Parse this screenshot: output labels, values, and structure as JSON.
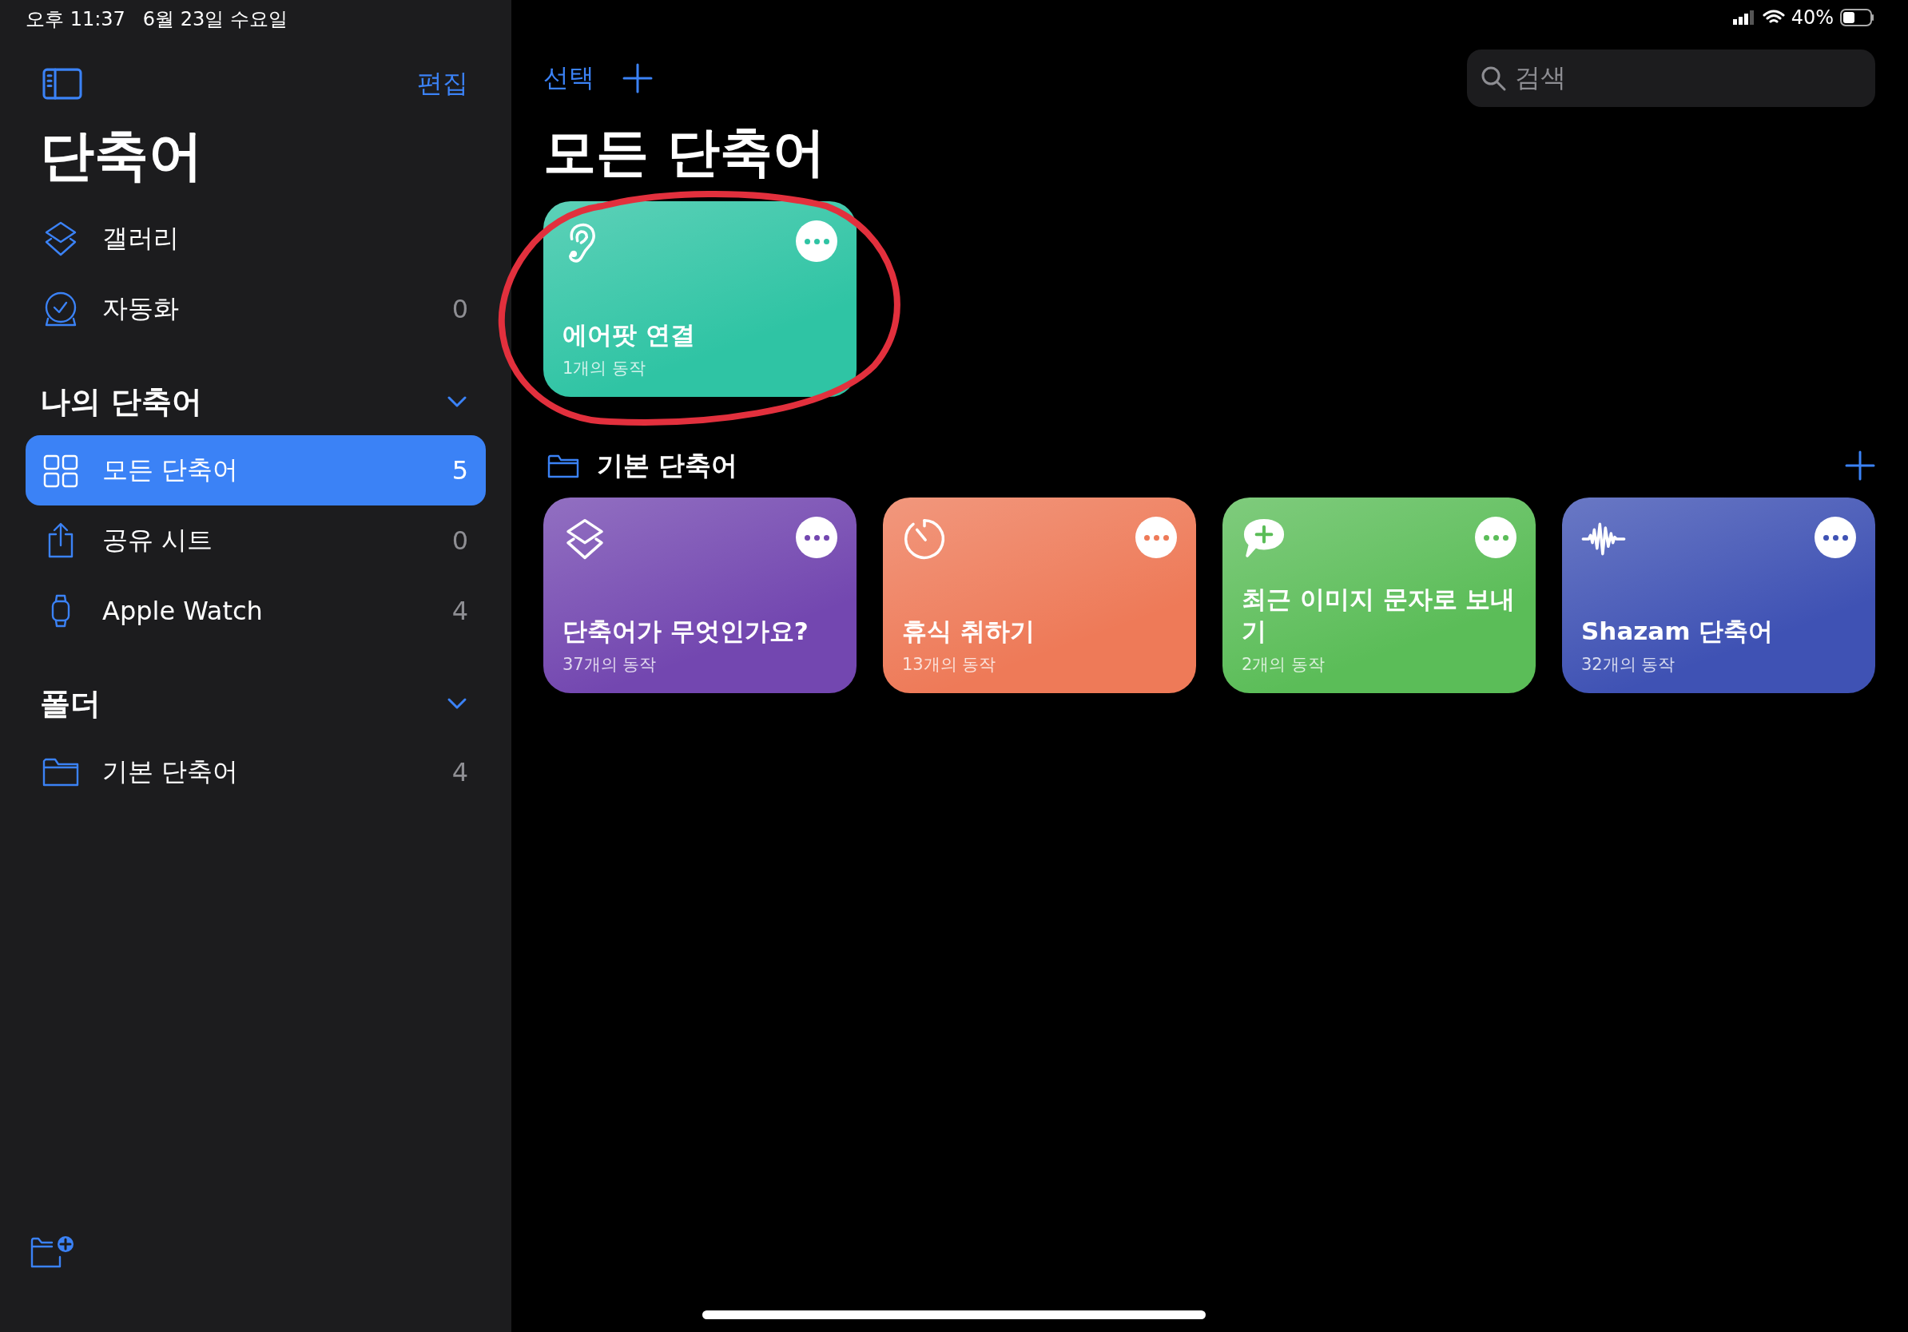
{
  "status_bar": {
    "time": "오후 11:37",
    "date": "6월 23일 수요일",
    "battery": "40%"
  },
  "sidebar": {
    "edit_button": "편집",
    "title": "단축어",
    "items": [
      {
        "label": "갤러리"
      },
      {
        "label": "자동화",
        "count": "0"
      }
    ],
    "sections": [
      {
        "title": "나의 단축어",
        "expanded": true,
        "items": [
          {
            "label": "모든 단축어",
            "count": "5",
            "selected": true
          },
          {
            "label": "공유 시트",
            "count": "0",
            "selected": false
          },
          {
            "label": "Apple Watch",
            "count": "4",
            "selected": false
          }
        ]
      },
      {
        "title": "폴더",
        "expanded": true,
        "items": [
          {
            "label": "기본 단축어",
            "count": "4",
            "selected": false
          }
        ]
      }
    ]
  },
  "main": {
    "select_button": "선택",
    "search": {
      "placeholder": "검색"
    },
    "title": "모든 단축어",
    "shortcuts": [
      {
        "title": "에어팟 연결",
        "subtitle": "1개의 동작",
        "color": "#2fc4a4",
        "highlighted": true
      }
    ],
    "folder": {
      "title": "기본 단축어",
      "shortcuts": [
        {
          "title": "단축어가 무엇인가요?",
          "subtitle": "37개의 동작",
          "color": "#7347b0",
          "highlighted": false
        },
        {
          "title": "휴식 취하기",
          "subtitle": "13개의 동작",
          "color": "#ee7a58",
          "highlighted": false
        },
        {
          "title": "최근 이미지 문자로 보내기",
          "subtitle": "2개의 동작",
          "color": "#5bbd58",
          "highlighted": false
        },
        {
          "title": "Shazam 단축어",
          "subtitle": "32개의 동작",
          "color": "#3f52b4",
          "highlighted": false
        }
      ]
    }
  }
}
